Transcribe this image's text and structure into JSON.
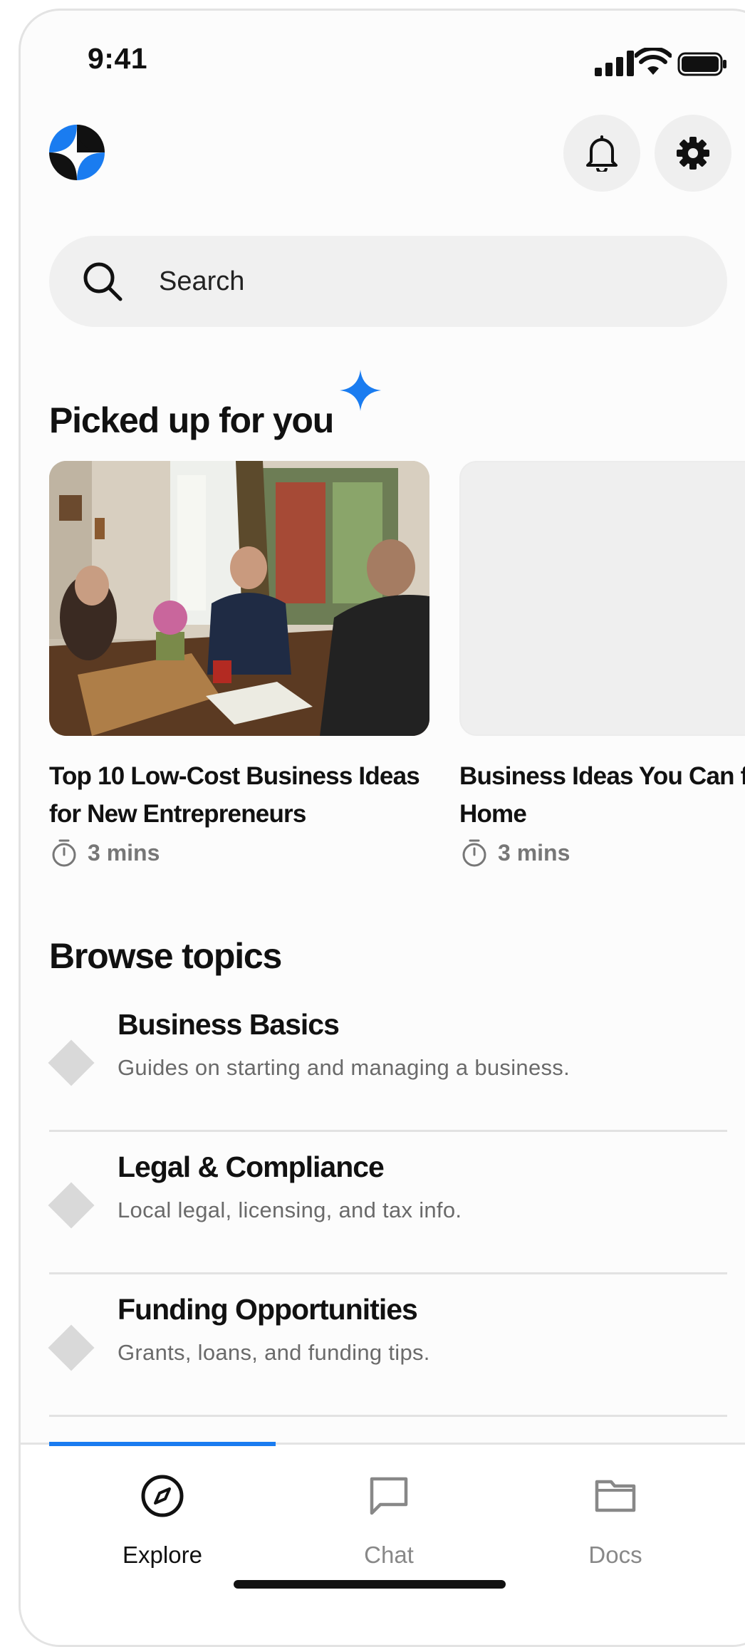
{
  "status_bar": {
    "time": "9:41"
  },
  "header": {
    "logo_icon": "four-point-star-logo-icon",
    "notifications_icon": "bell-icon",
    "settings_icon": "gear-icon"
  },
  "search": {
    "placeholder": "Search",
    "icon": "search-icon"
  },
  "picked": {
    "title": "Picked up for you",
    "cards": [
      {
        "title": "Top 10 Low-Cost Business Ideas for New Entrepreneurs",
        "duration": "3 mins"
      },
      {
        "title": "Business Ideas You Can from Home",
        "duration": "3 mins"
      }
    ]
  },
  "browse": {
    "title": "Browse topics",
    "topics": [
      {
        "title": "Business Basics",
        "description": "Guides on starting and managing a business."
      },
      {
        "title": "Legal & Compliance",
        "description": "Local legal, licensing, and tax info."
      },
      {
        "title": "Funding Opportunities",
        "description": "Grants, loans, and funding tips."
      }
    ]
  },
  "tabs": [
    {
      "label": "Explore",
      "icon": "compass-icon",
      "active": true
    },
    {
      "label": "Chat",
      "icon": "chat-bubble-icon",
      "active": false
    },
    {
      "label": "Docs",
      "icon": "folder-icon",
      "active": false
    }
  ],
  "colors": {
    "accent": "#1a7cf0",
    "text": "#111111",
    "muted": "#6a6a6a",
    "surface": "#f0f0f0"
  }
}
